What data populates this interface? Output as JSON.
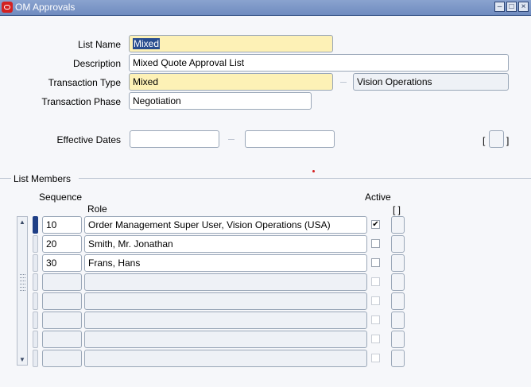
{
  "window": {
    "title": "OM Approvals"
  },
  "header": {
    "list_name_label": "List Name",
    "list_name_value": "Mixed",
    "description_label": "Description",
    "description_value": "Mixed Quote Approval List",
    "transaction_type_label": "Transaction Type",
    "transaction_type_value": "Mixed",
    "operating_unit_value": "Vision Operations",
    "transaction_phase_label": "Transaction Phase",
    "transaction_phase_value": "Negotiation",
    "effective_dates_label": "Effective Dates",
    "effective_from_value": "",
    "effective_to_value": "",
    "flex_bracket_open": "[",
    "flex_bracket_close": "]"
  },
  "members": {
    "section_title": "List Members",
    "col_sequence": "Sequence",
    "col_role": "Role",
    "col_active": "Active",
    "col_flex": "[ ]",
    "rows": [
      {
        "sequence": "10",
        "role": "Order Management Super User, Vision Operations (USA)",
        "active": true
      },
      {
        "sequence": "20",
        "role": "Smith, Mr. Jonathan",
        "active": false
      },
      {
        "sequence": "30",
        "role": "Frans, Hans",
        "active": false
      },
      {
        "sequence": "",
        "role": "",
        "active": false
      },
      {
        "sequence": "",
        "role": "",
        "active": false
      },
      {
        "sequence": "",
        "role": "",
        "active": false
      },
      {
        "sequence": "",
        "role": "",
        "active": false
      },
      {
        "sequence": "",
        "role": "",
        "active": false
      }
    ]
  },
  "icons": {
    "check_mark": "✔",
    "scroll_up": "▲",
    "scroll_down": "▼",
    "minimize": "–",
    "maximize": "□",
    "close": "×"
  }
}
